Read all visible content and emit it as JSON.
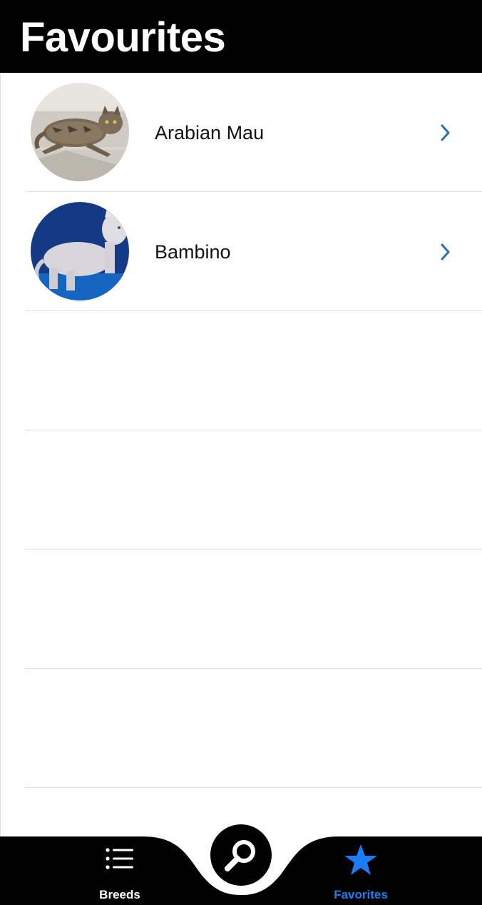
{
  "header": {
    "title": "Favourites"
  },
  "favorites": [
    {
      "name": "Arabian Mau"
    },
    {
      "name": "Bambino"
    }
  ],
  "tabbar": {
    "breeds_label": "Breeds",
    "favorites_label": "Favorites",
    "search_icon": "search-icon"
  },
  "colors": {
    "accent": "#1a7df7",
    "header_bg": "#000000",
    "tabbar_bg": "#000000",
    "chevron": "#2f6fb6"
  }
}
